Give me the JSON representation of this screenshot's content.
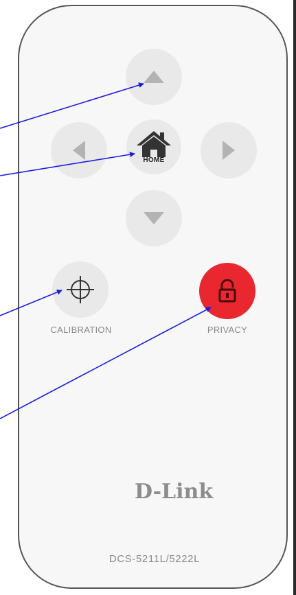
{
  "remote": {
    "buttons": {
      "up": {
        "icon": "triangle-up-icon"
      },
      "left": {
        "icon": "triangle-left-icon"
      },
      "home": {
        "icon": "house-icon",
        "label": "HOME"
      },
      "right": {
        "icon": "triangle-right-icon"
      },
      "down": {
        "icon": "triangle-down-icon"
      },
      "calibration": {
        "icon": "crosshair-icon",
        "label": "CALIBRATION"
      },
      "privacy": {
        "icon": "padlock-icon",
        "label": "PRIVACY"
      }
    },
    "brand": "D-Link",
    "model": "DCS-5211L/5222L"
  },
  "colors": {
    "body": "#f7f7f7",
    "outline": "#555555",
    "button": "#e9e9e9",
    "arrow_icon": "#b3b3b3",
    "privacy_button": "#e8272e",
    "callout_arrows": "#1d1de0",
    "label_text": "#8a8a8a"
  }
}
